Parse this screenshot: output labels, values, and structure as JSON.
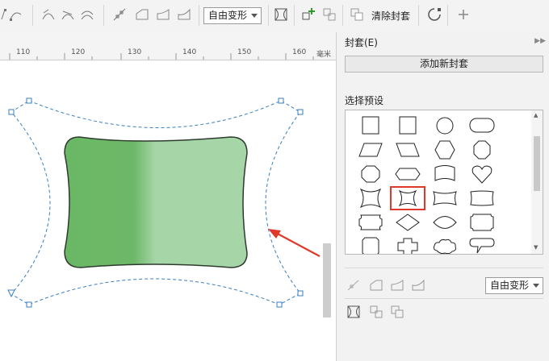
{
  "toolbar": {
    "mode_value": "自由变形",
    "clear_label": "清除封套",
    "icons": [
      "node-tool-icon",
      "curve-tool-icon",
      "pen-curve-icon",
      "pen-curve-alt-icon",
      "pen-curve-outline-icon",
      "pen-line-icon",
      "envelope-straight-icon",
      "envelope-single-arc-icon",
      "envelope-double-arc-icon",
      "envelope-shape-icon",
      "add-envelope-icon",
      "copy-envelope-icon",
      "clone-envelope-icon",
      "convert-to-curves-icon",
      "add-icon"
    ]
  },
  "ruler": {
    "labels": [
      "110",
      "120",
      "130",
      "140",
      "150",
      "160"
    ],
    "unit": "毫米"
  },
  "panel": {
    "title": "封套(E)",
    "add_button": "添加新封套",
    "preset_label": "选择预设",
    "mode_value": "自由变形",
    "presets": [
      "square",
      "square",
      "circle",
      "rounded-rect",
      "parallelogram-left",
      "parallelogram-right",
      "hexagon",
      "octagon",
      "octagon-small",
      "capsule",
      "flag",
      "heart",
      "pinched-square",
      "pinched-square-selected",
      "wave-rect",
      "wave-rect-2",
      "curly-rect",
      "diamond",
      "lens",
      "curly-rect-2",
      "badge",
      "cross",
      "cloud",
      "speech-bubble"
    ],
    "selected_preset": 13
  },
  "colors": {
    "shape_fill_dark": "#6ab866",
    "shape_fill_light": "#a6d6a8",
    "selection_red": "#e0392b",
    "envelope_line": "#3a7fc0"
  }
}
